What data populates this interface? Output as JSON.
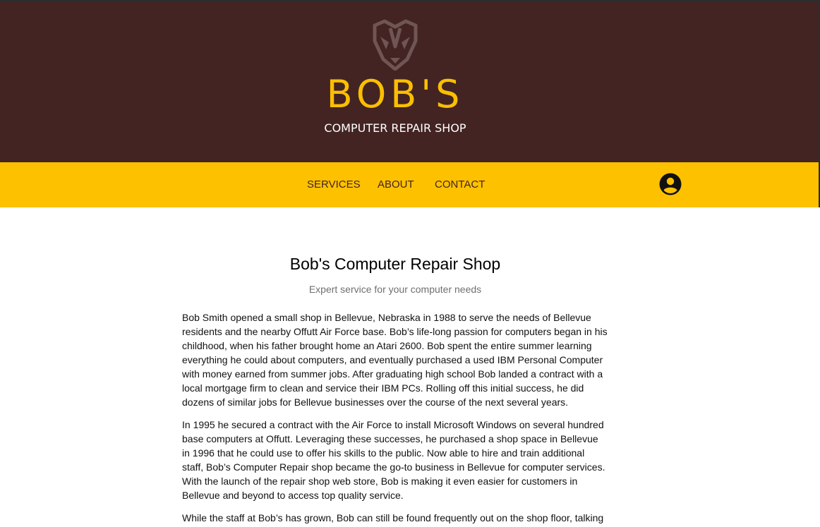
{
  "header": {
    "brand_name": "BOB'S",
    "brand_subtitle": "COMPUTER REPAIR SHOP",
    "logo_icon": "badger-logo-icon"
  },
  "nav": {
    "items": [
      {
        "label": "SERVICES"
      },
      {
        "label": "ABOUT"
      },
      {
        "label": "CONTACT"
      }
    ],
    "account_icon": "account-circle-icon"
  },
  "main": {
    "title": "Bob's Computer Repair Shop",
    "subtitle": "Expert service for your computer needs",
    "paragraphs": [
      "Bob Smith opened a small shop in Bellevue, Nebraska in 1988 to serve the needs of Bellevue residents and the nearby Offutt Air Force base. Bob’s life-long passion for computers began in his childhood, when his father brought home an Atari 2600. Bob spent the entire summer learning everything he could about computers, and eventually purchased a used IBM Personal Computer with money earned from summer jobs. After graduating high school Bob landed a contract with a local mortgage firm to clean and service their IBM PCs. Rolling off this initial success, he did dozens of similar jobs for Bellevue businesses over the course of the next several years.",
      "In 1995 he secured a contract with the Air Force to install Microsoft Windows on several hundred base computers at Offutt. Leveraging these successes, he purchased a shop space in Bellevue in 1996 that he could use to offer his skills to the public. Now able to hire and train additional staff, Bob’s Computer Repair shop became the go-to business in Bellevue for computer services. With the launch of the repair shop web store, Bob is making it even easier for customers in Bellevue and beyond to access top quality service.",
      "While the staff at Bob’s has grown, Bob can still be found frequently out on the shop floor, talking"
    ]
  },
  "colors": {
    "header_bg": "#432423",
    "brand_yellow": "#fcbf00",
    "nav_bg": "#fec100",
    "nav_text": "#432423"
  }
}
